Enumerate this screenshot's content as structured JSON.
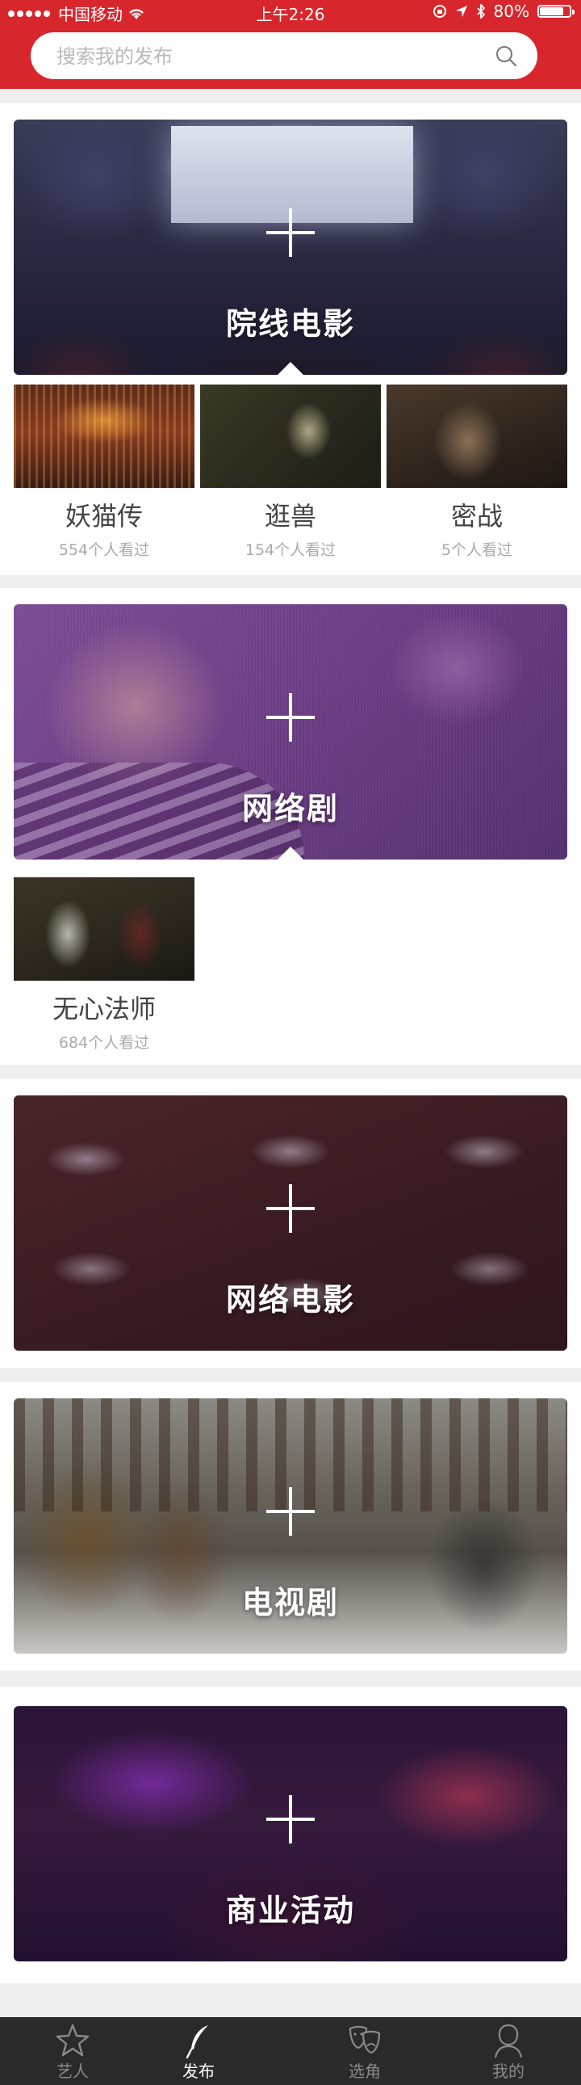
{
  "status_bar": {
    "carrier": "中国移动",
    "time": "上午2:26",
    "battery": "80%",
    "battery_level": 0.8
  },
  "search": {
    "placeholder": "搜索我的发布",
    "icon": "search-icon"
  },
  "sections": [
    {
      "title": "院线电影",
      "items": [
        {
          "title": "妖猫传",
          "views": "554个人看过"
        },
        {
          "title": "逛兽",
          "views": "154个人看过"
        },
        {
          "title": "密战",
          "views": "5个人看过"
        }
      ]
    },
    {
      "title": "网络剧",
      "items": [
        {
          "title": "无心法师",
          "views": "684个人看过"
        }
      ]
    },
    {
      "title": "网络电影",
      "items": []
    },
    {
      "title": "电视剧",
      "items": []
    },
    {
      "title": "商业活动",
      "items": []
    }
  ],
  "tabbar": {
    "tabs": [
      {
        "label": "艺人",
        "icon": "star-icon",
        "active": false
      },
      {
        "label": "发布",
        "icon": "feather-icon",
        "active": true
      },
      {
        "label": "选角",
        "icon": "masks-icon",
        "active": false
      },
      {
        "label": "我的",
        "icon": "profile-icon",
        "active": false
      }
    ]
  },
  "colors": {
    "brand_red": "#d8262d",
    "tabbar_bg": "#2a2a2a"
  }
}
